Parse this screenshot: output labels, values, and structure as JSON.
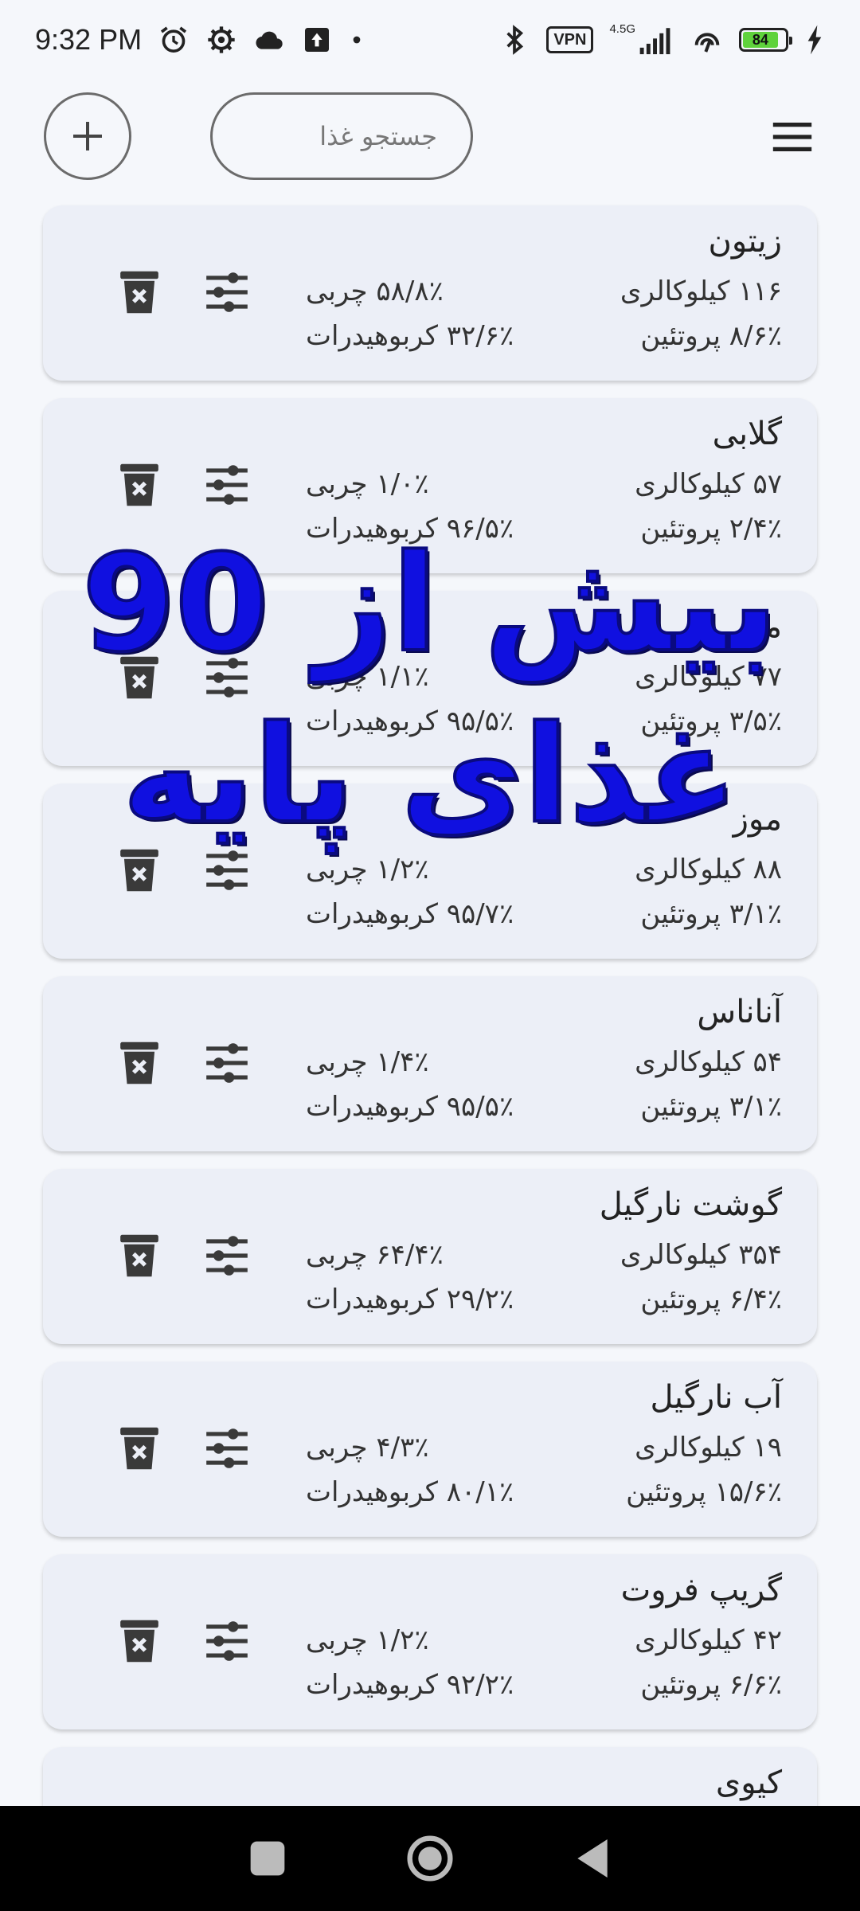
{
  "status_bar": {
    "time": "9:32 PM",
    "network_label": "4.5G",
    "vpn_label": "VPN",
    "battery_percent": "84",
    "icons": [
      "alarm-icon",
      "settings-gear-icon",
      "cloud-icon",
      "upload-icon",
      "dot-icon",
      "bluetooth-icon",
      "vpn-icon",
      "signal-icon",
      "hotspot-icon",
      "battery-icon",
      "charging-icon"
    ]
  },
  "top_bar": {
    "search_placeholder": "جستجو غذا",
    "add_icon": "plus-icon",
    "menu_icon": "hamburger-menu-icon"
  },
  "foods": [
    {
      "name": "زیتون",
      "calories": "۱۱۶ کیلوکالری",
      "protein": "۸/۶٪ پروتئین",
      "fat": "۵۸/۸٪ چربی",
      "carbs": "۳۲/۶٪ کربوهیدرات"
    },
    {
      "name": "گلابی",
      "calories": "۵۷ کیلوکالری",
      "protein": "۲/۴٪ پروتئین",
      "fat": "۱/۰٪ چربی",
      "carbs": "۹۶/۵٪ کربوهیدرات"
    },
    {
      "name": "موز",
      "calories": "۷۷ کیلوکالری",
      "protein": "۳/۵٪ پروتئین",
      "fat": "۱/۱٪ چربی",
      "carbs": "۹۵/۵٪ کربوهیدرات"
    },
    {
      "name": "موز",
      "calories": "۸۸ کیلوکالری",
      "protein": "۳/۱٪ پروتئین",
      "fat": "۱/۲٪ چربی",
      "carbs": "۹۵/۷٪ کربوهیدرات"
    },
    {
      "name": "آناناس",
      "calories": "۵۴ کیلوکالری",
      "protein": "۳/۱٪ پروتئین",
      "fat": "۱/۴٪ چربی",
      "carbs": "۹۵/۵٪ کربوهیدرات"
    },
    {
      "name": "گوشت نارگیل",
      "calories": "۳۵۴ کیلوکالری",
      "protein": "۶/۴٪ پروتئین",
      "fat": "۶۴/۴٪ چربی",
      "carbs": "۲۹/۲٪ کربوهیدرات"
    },
    {
      "name": "آب نارگیل",
      "calories": "۱۹ کیلوکالری",
      "protein": "۱۵/۶٪ پروتئین",
      "fat": "۴/۳٪ چربی",
      "carbs": "۸۰/۱٪ کربوهیدرات"
    },
    {
      "name": "گریپ فروت",
      "calories": "۴۲ کیلوکالری",
      "protein": "۶/۶٪ پروتئین",
      "fat": "۱/۲٪ چربی",
      "carbs": "۹۲/۲٪ کربوهیدرات"
    },
    {
      "name": "کیوی"
    }
  ],
  "card_icons": {
    "delete": "trash-delete-icon",
    "edit": "sliders-adjust-icon"
  },
  "promo": {
    "line1": "بیش از 90",
    "line2": "غذای پایه"
  },
  "nav_bar": {
    "icons": [
      "recents-square-icon",
      "home-circle-icon",
      "back-triangle-icon"
    ]
  }
}
